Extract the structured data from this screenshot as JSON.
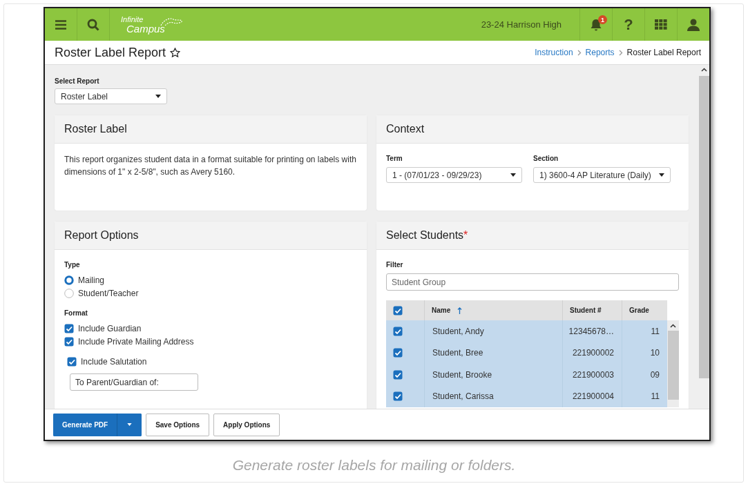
{
  "header": {
    "logo_line1": "Infinite",
    "logo_line2": "Campus",
    "school": "23-24 Harrison High",
    "notification_count": "1",
    "help": "?"
  },
  "page": {
    "title": "Roster Label Report",
    "favorite": false,
    "breadcrumbs": [
      {
        "label": "Instruction",
        "kind": "link"
      },
      {
        "label": "Reports",
        "kind": "link"
      },
      {
        "label": "Roster Label Report",
        "kind": "current"
      }
    ]
  },
  "select_report": {
    "label": "Select Report",
    "value": "Roster Label"
  },
  "roster_label": {
    "title": "Roster Label",
    "description": "This report organizes student data in a format suitable for printing on labels with dimensions of 1\" x 2-5/8\", such as Avery 5160."
  },
  "context": {
    "title": "Context",
    "fields": [
      {
        "label": "Term",
        "value": "1 - (07/01/23 - 09/29/23)"
      },
      {
        "label": "Section",
        "value": "1) 3600-4 AP Literature (Daily)"
      }
    ]
  },
  "report_options": {
    "title": "Report Options",
    "type_label": "Type",
    "types": [
      {
        "label": "Mailing",
        "selected": true
      },
      {
        "label": "Student/Teacher",
        "selected": false
      }
    ],
    "format_label": "Format",
    "formats": [
      {
        "label": "Include Guardian",
        "checked": true
      },
      {
        "label": "Include Private Mailing Address",
        "checked": true
      }
    ],
    "salutation": {
      "label": "Include Salutation",
      "checked": true,
      "value": "To Parent/Guardian of:"
    }
  },
  "select_students": {
    "title": "Select Students",
    "required_mark": "*",
    "filter_label": "Filter",
    "filter_placeholder": "Student Group",
    "all_checked": true,
    "columns": [
      {
        "label": "Name",
        "sorted": true
      },
      {
        "label": "Student #",
        "sorted": false
      },
      {
        "label": "Grade",
        "sorted": false
      }
    ],
    "rows": [
      {
        "name": "Student, Andy",
        "student_number": "12345678…",
        "grade": "11",
        "checked": true,
        "selected": true
      },
      {
        "name": "Student, Bree",
        "student_number": "221900002",
        "grade": "10",
        "checked": true,
        "selected": true
      },
      {
        "name": "Student, Brooke",
        "student_number": "221900003",
        "grade": "09",
        "checked": true,
        "selected": true
      },
      {
        "name": "Student, Carissa",
        "student_number": "221900004",
        "grade": "11",
        "checked": true,
        "selected": true
      }
    ]
  },
  "footer": {
    "buttons": [
      {
        "label": "Generate PDF",
        "kind": "primary"
      },
      {
        "label": "Save Options",
        "kind": "secondary"
      },
      {
        "label": "Apply Options",
        "kind": "secondary"
      }
    ]
  },
  "caption": "Generate roster labels for mailing or folders."
}
